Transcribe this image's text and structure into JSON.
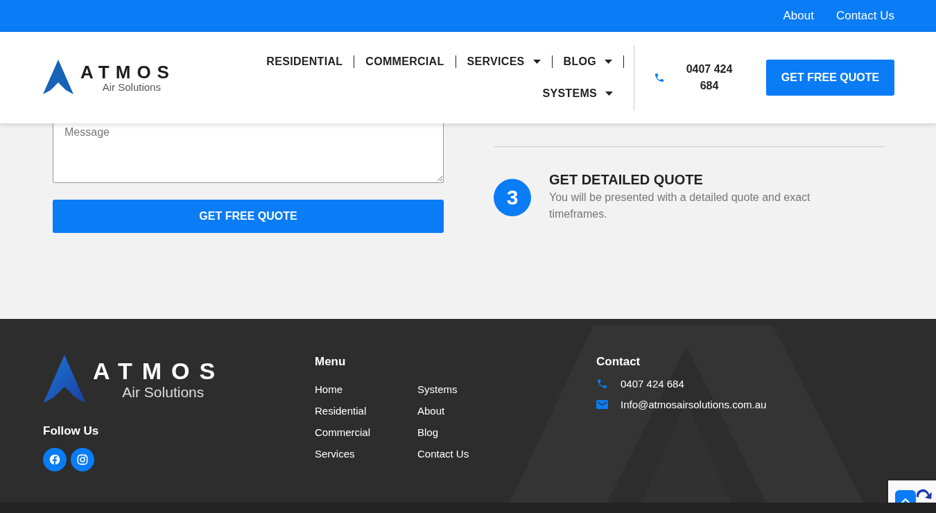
{
  "top_bar": {
    "links": [
      "About",
      "Contact Us"
    ]
  },
  "header": {
    "logo": {
      "name": "ATMOS",
      "tagline": "Air Solutions"
    },
    "nav": [
      {
        "label": "RESIDENTIAL",
        "dropdown": false
      },
      {
        "label": "COMMERCIAL",
        "dropdown": false
      },
      {
        "label": "SERVICES",
        "dropdown": true
      },
      {
        "label": "BLOG",
        "dropdown": true
      },
      {
        "label": "SYSTEMS",
        "dropdown": true
      }
    ],
    "phone": "0407 424 684",
    "cta": "GET FREE QUOTE"
  },
  "form": {
    "message": {
      "placeholder": "Message"
    },
    "submit": "GET FREE QUOTE"
  },
  "step": {
    "number": "3",
    "title": "GET DETAILED QUOTE",
    "text": "You will be presented with a detailed quote and exact timeframes."
  },
  "footer": {
    "logo": {
      "name": "ATMOS",
      "tagline": "Air Solutions"
    },
    "follow_title": "Follow Us",
    "social": [
      {
        "kind": "facebook"
      },
      {
        "kind": "instagram"
      }
    ],
    "menu": {
      "title": "Menu",
      "columns": [
        [
          "Home",
          "Residential",
          "Commercial",
          "Services"
        ],
        [
          "Systems",
          "About",
          "Blog",
          "Contact Us"
        ]
      ]
    },
    "contact": {
      "title": "Contact",
      "items": [
        {
          "kind": "phone",
          "text": "0407 424 684"
        },
        {
          "kind": "email",
          "text": "Info@atmosairsolutions.com.au"
        }
      ]
    }
  }
}
